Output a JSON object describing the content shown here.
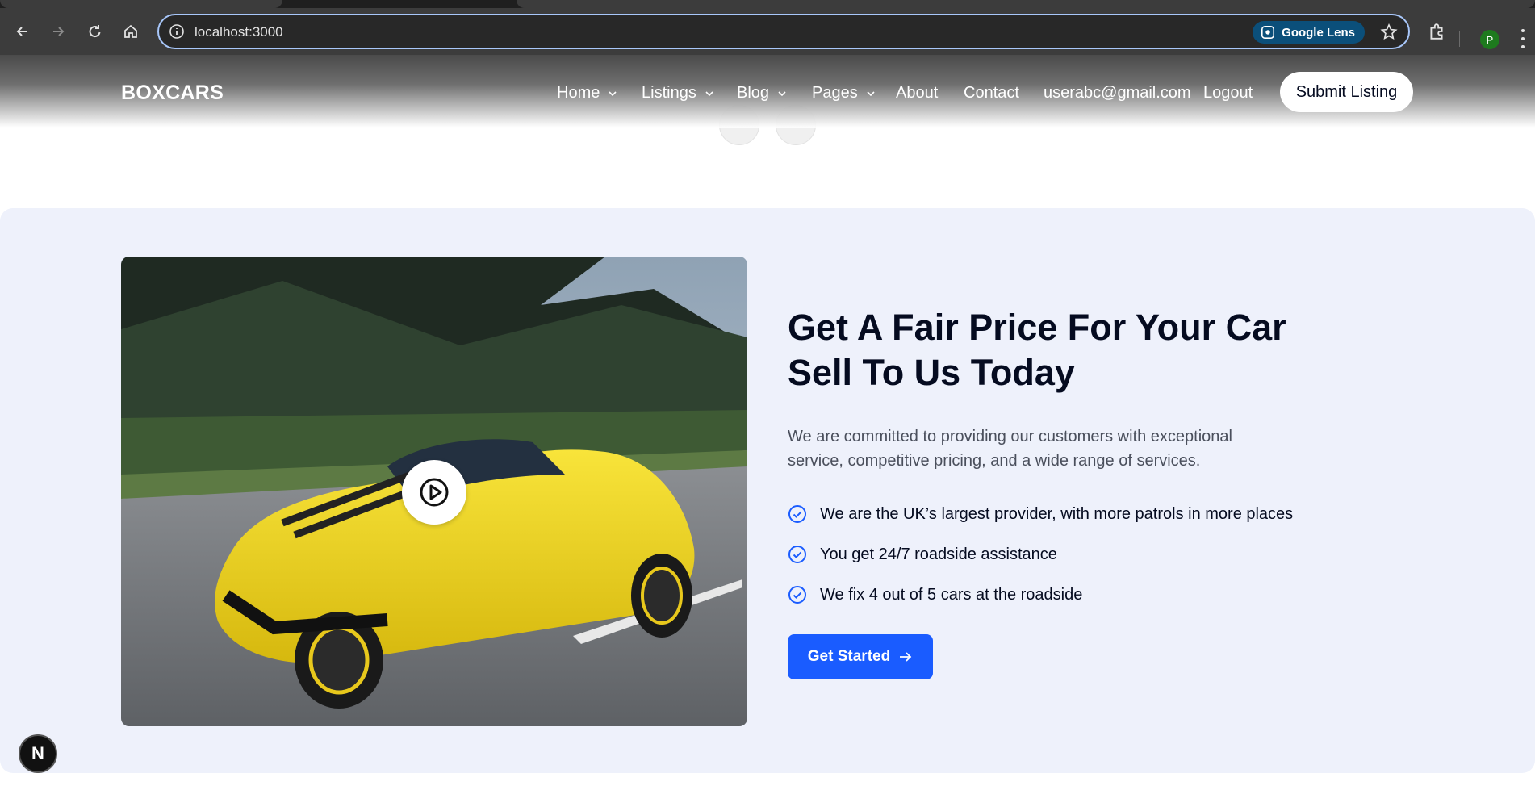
{
  "browser": {
    "url": "localhost:3000",
    "lens_label": "Google Lens",
    "profile_initial": "P"
  },
  "header": {
    "logo": "BOXCARS",
    "nav": [
      {
        "label": "Home",
        "dropdown": true
      },
      {
        "label": "Listings",
        "dropdown": true
      },
      {
        "label": "Blog",
        "dropdown": true
      },
      {
        "label": "Pages",
        "dropdown": true
      },
      {
        "label": "About",
        "dropdown": false
      },
      {
        "label": "Contact",
        "dropdown": false
      },
      {
        "label": "userabc@gmail.com",
        "dropdown": false
      },
      {
        "label": "Logout",
        "dropdown": false
      }
    ],
    "submit_label": "Submit Listing"
  },
  "hero": {
    "headline_line1": "Get A Fair Price For Your Car",
    "headline_line2": "Sell To Us Today",
    "description": "We are committed to providing our customers with exceptional service, competitive pricing, and a wide range of services.",
    "features": [
      "We are the UK’s largest provider, with more patrols in more places",
      "You get 24/7 roadside assistance",
      "We fix 4 out of 5 cars at the roadside"
    ],
    "cta_label": "Get Started"
  },
  "dev_badge": "N",
  "colors": {
    "accent": "#1a5cff",
    "section_bg": "#eef1fb",
    "heading": "#050b20"
  }
}
